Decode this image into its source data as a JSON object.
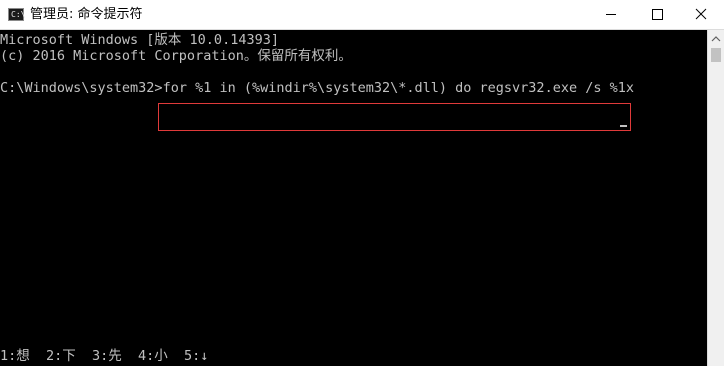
{
  "window": {
    "icon_glyph": "C:\\",
    "title": "管理员: 命令提示符",
    "controls": {
      "minimize": "minimize-icon",
      "maximize": "maximize-icon",
      "close": "close-icon"
    }
  },
  "console": {
    "lines": [
      "Microsoft Windows [版本 10.0.14393]",
      "(c) 2016 Microsoft Corporation。保留所有权利。"
    ],
    "prompt": "C:\\Windows\\system32>",
    "command": "for %1 in (%windir%\\system32\\*.dll) do regsvr32.exe /s %1x"
  },
  "ime_bar": "1:想  2:下  3:先  4:小  5:↓",
  "colors": {
    "console_bg": "#000000",
    "console_text": "#c0c0c0",
    "highlight_border": "#e03a3a",
    "titlebar_bg": "#ffffff"
  }
}
